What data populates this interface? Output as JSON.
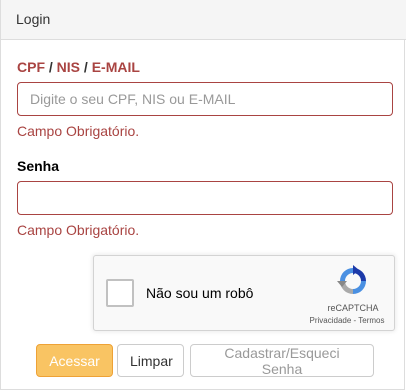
{
  "panel": {
    "title": "Login"
  },
  "cpf_field": {
    "label_cpf": "CPF",
    "label_sep1": " / ",
    "label_nis": "NIS",
    "label_sep2": " / ",
    "label_email": "E-MAIL",
    "placeholder": "Digite o seu CPF, NIS ou E-MAIL",
    "value": "",
    "error": "Campo Obrigatório."
  },
  "senha_field": {
    "label": "Senha",
    "value": "",
    "error": "Campo Obrigatório."
  },
  "captcha": {
    "checkbox_label": "Não sou um robô",
    "brand": "reCAPTCHA",
    "privacy": "Privacidade",
    "link_sep": " - ",
    "terms": "Termos",
    "checked": false
  },
  "buttons": {
    "acessar": "Acessar",
    "limpar": "Limpar",
    "cadastrar": "Cadastrar/Esqueci Senha"
  },
  "colors": {
    "error": "#a94442",
    "primary_button": "#f9c463"
  },
  "icons": [
    "recaptcha-logo-icon"
  ]
}
